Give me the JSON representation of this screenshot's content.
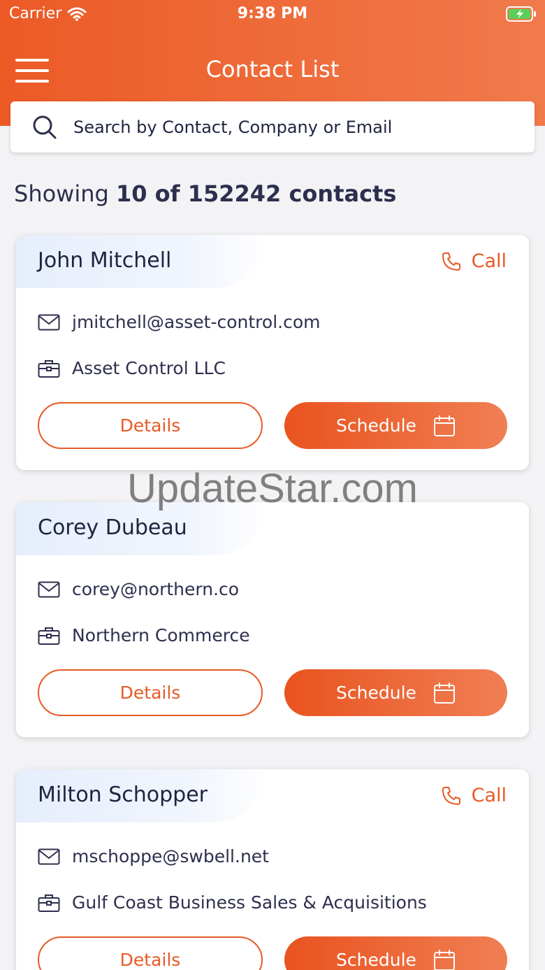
{
  "status_bar": {
    "carrier": "Carrier",
    "time": "9:38 PM"
  },
  "header": {
    "title": "Contact List"
  },
  "search": {
    "placeholder": "Search by Contact, Company or Email"
  },
  "summary": {
    "prefix": "Showing",
    "count_text": "10 of 152242 contacts"
  },
  "labels": {
    "call": "Call",
    "details": "Details",
    "schedule": "Schedule"
  },
  "contacts": [
    {
      "name": "John Mitchell",
      "email": "jmitchell@asset-control.com",
      "company": "Asset Control LLC",
      "has_call": true
    },
    {
      "name": "Corey Dubeau",
      "email": "corey@northern.co",
      "company": "Northern Commerce",
      "has_call": false
    },
    {
      "name": "Milton Schopper",
      "email": "mschoppe@swbell.net",
      "company": "Gulf Coast Business Sales & Acquisitions",
      "has_call": true
    }
  ],
  "watermark": "UpdateStar.com",
  "colors": {
    "accent": "#e85a27",
    "header_start": "#ec5a26",
    "header_end": "#f17a4c",
    "text": "#1f2440"
  },
  "icons": [
    "menu-icon",
    "wifi-icon",
    "battery-icon",
    "search-icon",
    "phone-icon",
    "mail-icon",
    "briefcase-icon",
    "calendar-icon"
  ]
}
